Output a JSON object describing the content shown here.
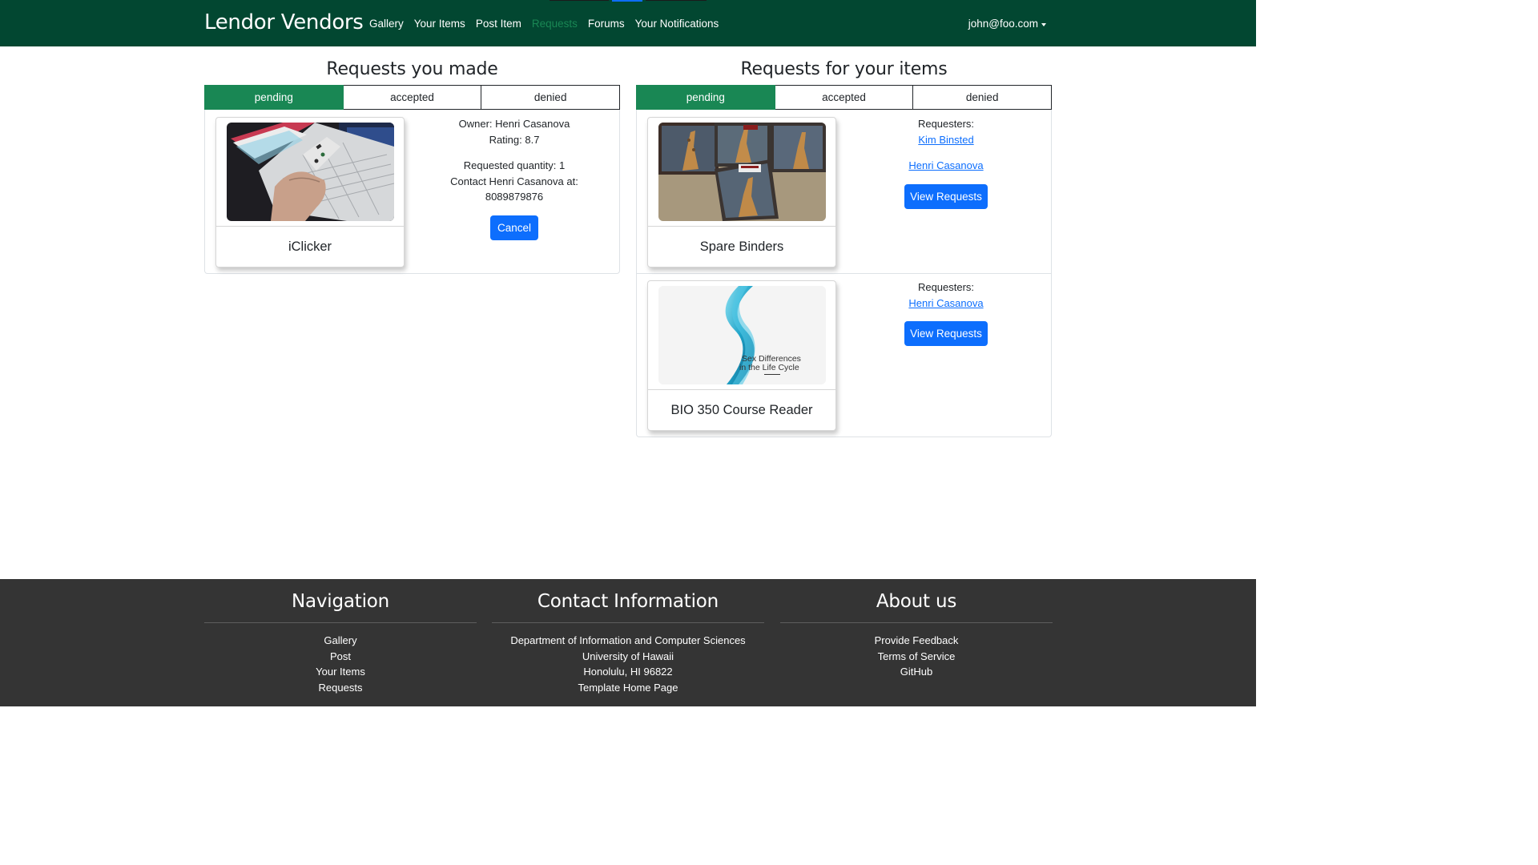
{
  "navbar": {
    "brand": "Lendor Vendors",
    "links": [
      "Gallery",
      "Your Items",
      "Post Item",
      "Requests",
      "Forums",
      "Your Notifications"
    ],
    "active_link": "Requests",
    "user": "john@foo.com"
  },
  "made": {
    "title": "Requests you made",
    "tabs": [
      "pending",
      "accepted",
      "denied"
    ],
    "active_tab": "pending",
    "items": [
      {
        "name": "iClicker",
        "owner_line": "Owner: Henri Casanova",
        "rating_line": "Rating: 8.7",
        "quantity_line": "Requested quantity: 1",
        "contact_line": "Contact Henri Casanova at:",
        "phone": "8089879876",
        "cancel_label": "Cancel"
      }
    ]
  },
  "for_items": {
    "title": "Requests for your items",
    "tabs": [
      "pending",
      "accepted",
      "denied"
    ],
    "active_tab": "pending",
    "items": [
      {
        "name": "Spare Binders",
        "requesters_label": "Requesters:",
        "requesters": [
          "Kim Binsted",
          "Henri Casanova"
        ],
        "view_label": "View Requests"
      },
      {
        "name": "BIO 350 Course Reader",
        "requesters_label": "Requesters:",
        "requesters": [
          "Henri Casanova"
        ],
        "view_label": "View Requests",
        "cover_text_line1": "Sex Differences",
        "cover_text_line2": "in the Life Cycle"
      }
    ]
  },
  "footer": {
    "navigation": {
      "title": "Navigation",
      "items": [
        "Gallery",
        "Post",
        "Your Items",
        "Requests"
      ]
    },
    "contact": {
      "title": "Contact Information",
      "items": [
        "Department of Information and Computer Sciences",
        "University of Hawaii",
        "Honolulu, HI 96822",
        "Template Home Page"
      ]
    },
    "about": {
      "title": "About us",
      "items": [
        "Provide Feedback",
        "Terms of Service",
        "GitHub"
      ]
    }
  },
  "colors": {
    "navbar_bg": "#024731",
    "active_tab": "#198754",
    "primary_button": "#0d6efd",
    "footer_bg": "#343434"
  }
}
